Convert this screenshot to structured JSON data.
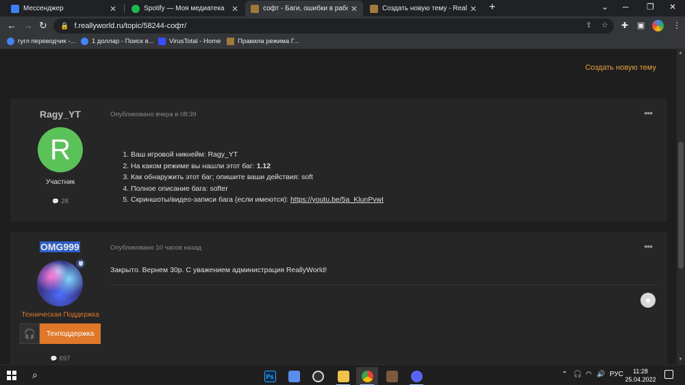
{
  "browser": {
    "tabs": [
      {
        "label": "Мессенджер",
        "icon": "messenger-icon",
        "color": "#3b82f6",
        "active": false
      },
      {
        "label": "Spotify — Моя медиатека",
        "icon": "spotify-icon",
        "color": "#1db954",
        "active": false
      },
      {
        "label": "софт - Баги, ошибки в работе с",
        "icon": "reallyworld-icon",
        "color": "#a07a3a",
        "active": true
      },
      {
        "label": "Создать новую тему - ReallyWor",
        "icon": "reallyworld-icon",
        "color": "#a07a3a",
        "active": false
      }
    ],
    "new_tab": "+",
    "url": "f.reallyworld.ru/topic/58244-софт/",
    "bookmarks": [
      {
        "label": "гугл переводчик -...",
        "icon": "google-icon",
        "color": "#4285f4"
      },
      {
        "label": "1 доллар - Поиск в...",
        "icon": "google-icon",
        "color": "#4285f4"
      },
      {
        "label": "VirusTotal - Home",
        "icon": "virustotal-icon",
        "color": "#394eff"
      },
      {
        "label": "Правила режима Г...",
        "icon": "reallyworld-icon",
        "color": "#a07a3a"
      }
    ]
  },
  "page": {
    "create_topic": "Создать новую тему",
    "posts": [
      {
        "author": "Ragy_YT",
        "avatar_letter": "R",
        "avatar_color": "#5bc25a",
        "role": "Участник",
        "post_count": "28",
        "posted": "Опубликовано вчера в 08:39",
        "items": [
          "Ваш игровой никнейм: Ragy_YT",
          "На каком режиме вы нашли этот баг: ",
          "Как обнаружить этот баг; опишите ваши действия: soft",
          "Полное описание бага: softer",
          "Скриншоты/видео-записи бага (если имеются): "
        ],
        "mode_value": "1.12",
        "link": "https://youtu.be/5a_KlunPvwI"
      },
      {
        "author": "OMG999",
        "role": "Техническая Поддержка",
        "role_color": "#e0782a",
        "group_label": "Техподдержка",
        "post_count": "697",
        "posted": "Опубликовано 10 часов назад",
        "text": "Закрыто. Вернем 30р. С уважением администрация ReallyWorld!"
      }
    ]
  },
  "taskbar": {
    "apps": [
      {
        "name": "photoshop-icon",
        "label": "Ps",
        "color": "#0b2a4a"
      },
      {
        "name": "app-icon",
        "label": "",
        "color": "#5b8def"
      },
      {
        "name": "obs-icon",
        "label": "",
        "color": "#333"
      },
      {
        "name": "file-explorer-icon",
        "label": "",
        "color": "#f0c24b"
      },
      {
        "name": "chrome-icon",
        "label": "",
        "color": "#4285f4"
      },
      {
        "name": "minecraft-icon",
        "label": "",
        "color": "#7a5a3a"
      },
      {
        "name": "discord-icon",
        "label": "",
        "color": "#5865f2"
      }
    ],
    "language": "РУС",
    "time": "11:28",
    "date": "25.04.2022"
  }
}
